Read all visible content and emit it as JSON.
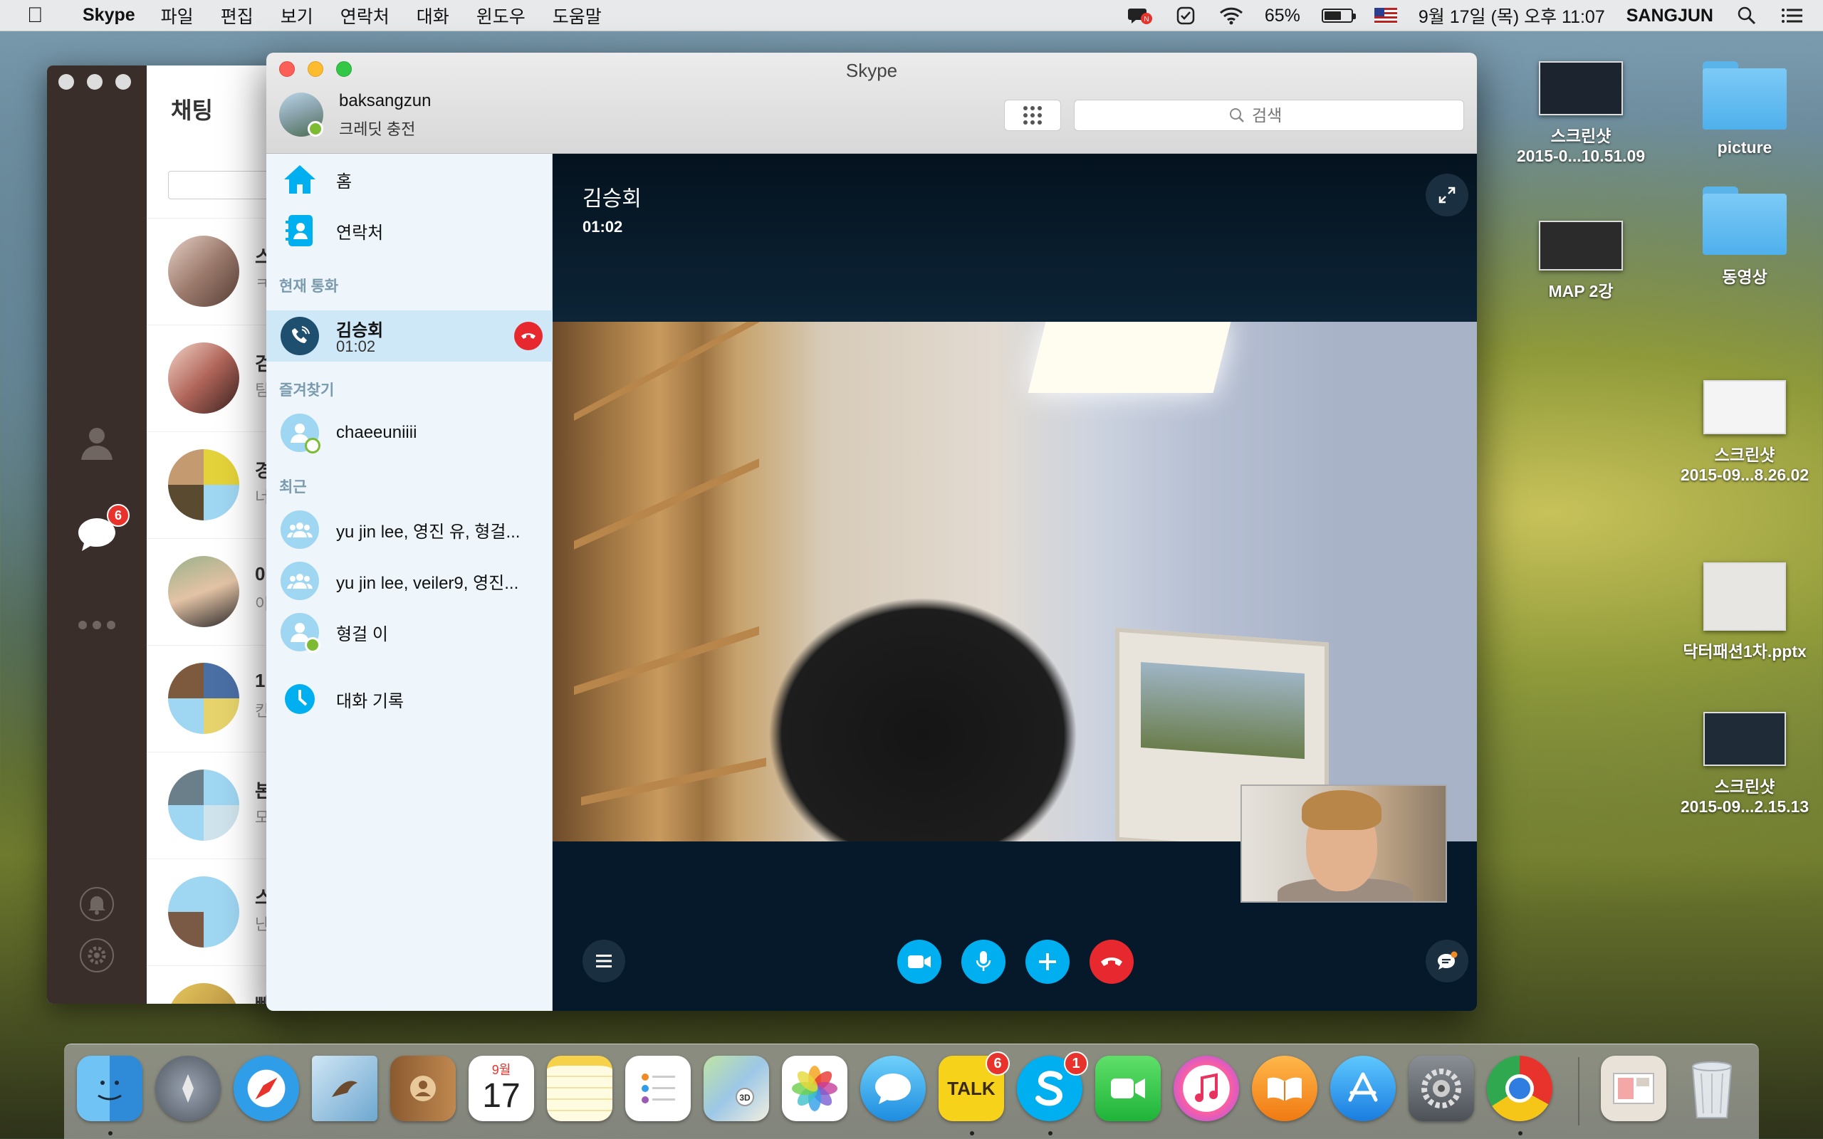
{
  "menubar": {
    "app_name": "Skype",
    "menus": [
      "파일",
      "편집",
      "보기",
      "연락처",
      "대화",
      "윈도우",
      "도움말"
    ],
    "battery": "65%",
    "battery_level": 0.65,
    "datetime": "9월 17일 (목) 오후 11:07",
    "user": "SANGJUN",
    "icons": [
      "apple-icon",
      "notification-chat-icon",
      "checkbox-icon",
      "wifi-icon",
      "battery-icon",
      "us-flag-icon",
      "search-icon",
      "list-icon"
    ]
  },
  "desktop": {
    "items": [
      {
        "line1": "스크린샷",
        "line2": "2015-0...10.51.09"
      },
      {
        "line1": "picture",
        "line2": ""
      },
      {
        "line1": "MAP 2강",
        "line2": ""
      },
      {
        "line1": "동영상",
        "line2": ""
      },
      {
        "line1": "스크린샷",
        "line2": "2015-09...8.26.02"
      },
      {
        "line1": "닥터패션1차.pptx",
        "line2": ""
      },
      {
        "line1": "스크린샷",
        "line2": "2015-09...2.15.13"
      }
    ]
  },
  "back_window": {
    "title": "채팅",
    "chat_badge": "6",
    "rows": [
      {
        "t1": "스",
        "t2": "ㅋ"
      },
      {
        "t1": "검",
        "t2": "팀"
      },
      {
        "t1": "경",
        "t2": "너"
      },
      {
        "t1": "0",
        "t2": "이"
      },
      {
        "t1": "1",
        "t2": "킨"
      },
      {
        "t1": "본",
        "t2": "모"
      },
      {
        "t1": "스",
        "t2": "난"
      },
      {
        "t1": "빼",
        "t2": ""
      }
    ]
  },
  "window": {
    "title": "Skype",
    "profile": {
      "name": "baksangzun",
      "credit": "크레딧 충전"
    },
    "search_placeholder": "검색",
    "sidebar": {
      "home": "홈",
      "contacts": "연락처",
      "current_call_section": "현재 통화",
      "current_call": {
        "name": "김승회",
        "duration": "01:02"
      },
      "favorites_section": "즐겨찾기",
      "favorite": "chaeeuniiii",
      "recent_section": "최근",
      "recent": [
        "yu jin lee, 영진 유, 형걸...",
        "yu jin lee, veiler9, 영진...",
        "형걸 이"
      ],
      "history": "대화 기록"
    },
    "call": {
      "name": "김승회",
      "duration": "01:02"
    }
  },
  "dock": {
    "apps": [
      "Finder",
      "Launchpad",
      "Safari",
      "Mail",
      "Contacts",
      "Calendar",
      "Notes",
      "Reminders",
      "Maps",
      "Photos",
      "Messages",
      "KakaoTalk",
      "Skype",
      "FaceTime",
      "iTunes",
      "iBooks",
      "App Store",
      "System Preferences",
      "Chrome",
      "Downloads",
      "Trash"
    ],
    "calendar_month": "9월",
    "calendar_day": "17",
    "kakao_label": "TALK",
    "kakao_badge": "6",
    "skype_badge": "1"
  },
  "colors": {
    "skype_blue": "#00aff0",
    "hangup_red": "#e8282f",
    "presence_green": "#7dbb33",
    "sidebar_bg": "#eef6fb"
  }
}
